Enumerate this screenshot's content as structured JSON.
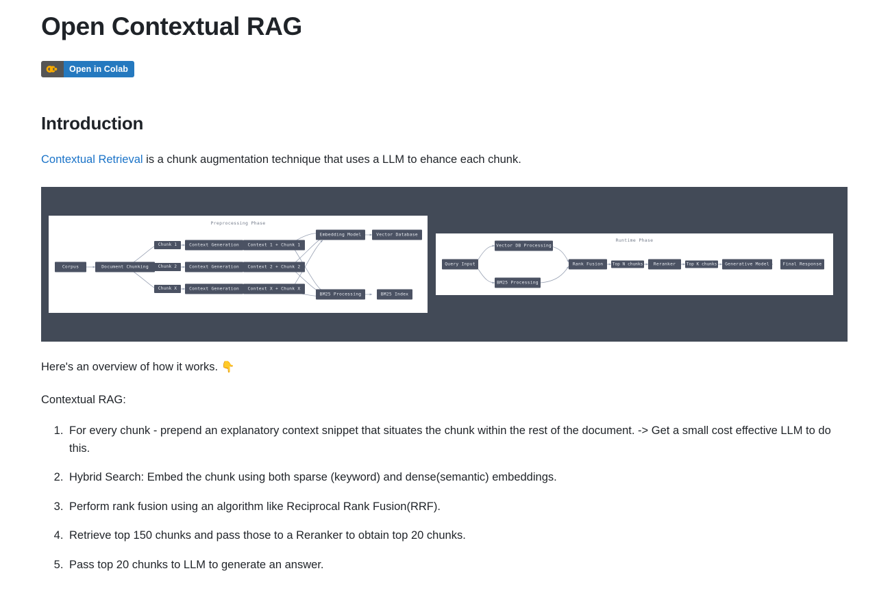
{
  "document": {
    "title": "Open Contextual RAG"
  },
  "badge": {
    "logo_name": "colab-logo",
    "label": "Open in Colab",
    "left_bg": "#555555",
    "right_bg": "#2579bf",
    "logo_color": "#f9ab00"
  },
  "intro": {
    "heading": "Introduction",
    "link_text": "Contextual Retrieval",
    "paragraph_rest": " is a chunk augmentation technique that uses a LLM to ehance each chunk.",
    "link_color": "#1a73c8"
  },
  "figure": {
    "alt": "contextual-rag-architecture-diagram",
    "background": "#424a57",
    "node_bg": "#4b5263",
    "node_text": "#e6e9ef",
    "edge_color": "#98a1b3",
    "preprocessing": {
      "phase_title": "Preprocessing Phase",
      "nodes": [
        "Corpus",
        "Document Chunking",
        "Chunk 1",
        "Chunk 2",
        "Chunk X",
        "Context Generation",
        "Context Generation",
        "Context Generation",
        "Context 1 + Chunk 1",
        "Context 2 + Chunk 2",
        "Context X + Chunk X",
        "Embedding Model",
        "Vector Database",
        "BM25 Processing",
        "BM25 Index"
      ]
    },
    "runtime": {
      "phase_title": "Runtime Phase",
      "nodes": [
        "Query Input",
        "Vector DB Processing",
        "BM25 Processing",
        "Rank Fusion",
        "Reranker",
        "Generative Model",
        "Final Response"
      ],
      "edge_labels": [
        "Top N chunks",
        "Top K chunks"
      ]
    }
  },
  "overview": {
    "caption": "Here's an overview of how it works. ",
    "caption_emoji": "👇",
    "list_intro": "Contextual RAG:",
    "steps": [
      "For every chunk - prepend an explanatory context snippet that situates the chunk within the rest of the document. -> Get a small cost effective LLM to do this.",
      "Hybrid Search: Embed the chunk using both sparse (keyword) and dense(semantic) embeddings.",
      "Perform rank fusion using an algorithm like Reciprocal Rank Fusion(RRF).",
      "Retrieve top 150 chunks and pass those to a Reranker to obtain top 20 chunks.",
      "Pass top 20 chunks to LLM to generate an answer."
    ]
  }
}
